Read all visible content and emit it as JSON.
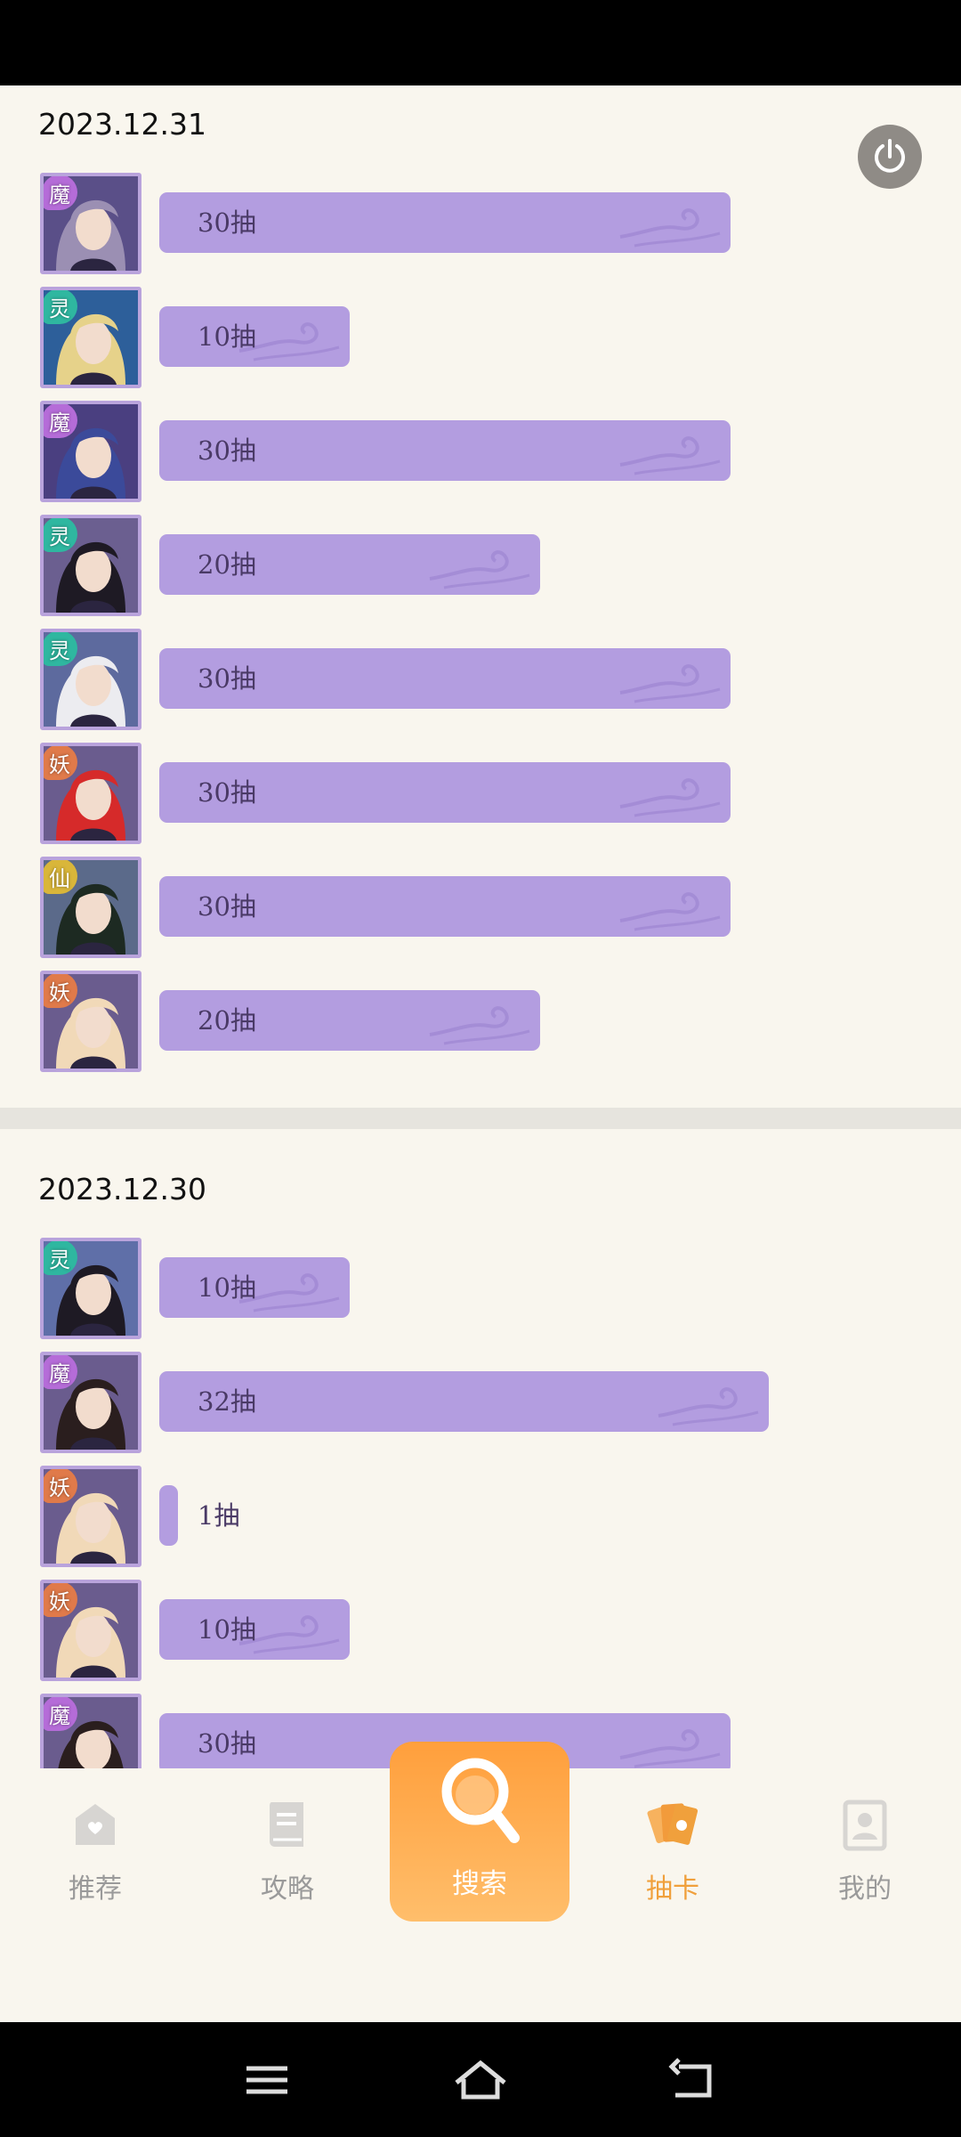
{
  "sections": [
    {
      "date": "2023.12.31",
      "rows": [
        {
          "faction": "魔",
          "faction_color": "#b56cd8",
          "hair": "#9b8fb3",
          "bg": "#5a4f88",
          "pulls": 30,
          "label": "30抽"
        },
        {
          "faction": "灵",
          "faction_color": "#2fb7a0",
          "hair": "#e6d28a",
          "bg": "#2d5f9a",
          "pulls": 10,
          "label": "10抽"
        },
        {
          "faction": "魔",
          "faction_color": "#b56cd8",
          "hair": "#3b4a9a",
          "bg": "#4a3f80",
          "pulls": 30,
          "label": "30抽"
        },
        {
          "faction": "灵",
          "faction_color": "#2fb7a0",
          "hair": "#1e1a24",
          "bg": "#6b5f90",
          "pulls": 20,
          "label": "20抽"
        },
        {
          "faction": "灵",
          "faction_color": "#2fb7a0",
          "hair": "#ececf0",
          "bg": "#5d6a9e",
          "pulls": 30,
          "label": "30抽"
        },
        {
          "faction": "妖",
          "faction_color": "#e07a4a",
          "hair": "#d62a2a",
          "bg": "#6a5c8e",
          "pulls": 30,
          "label": "30抽"
        },
        {
          "faction": "仙",
          "faction_color": "#d9b63a",
          "hair": "#1d2a22",
          "bg": "#5b6a8a",
          "pulls": 30,
          "label": "30抽"
        },
        {
          "faction": "妖",
          "faction_color": "#e07a4a",
          "hair": "#f1d9b8",
          "bg": "#6a5c8e",
          "pulls": 20,
          "label": "20抽"
        }
      ]
    },
    {
      "date": "2023.12.30",
      "rows": [
        {
          "faction": "灵",
          "faction_color": "#2fb7a0",
          "hair": "#1e1a24",
          "bg": "#5f6fa8",
          "pulls": 10,
          "label": "10抽"
        },
        {
          "faction": "魔",
          "faction_color": "#b56cd8",
          "hair": "#2a1e1e",
          "bg": "#6a5c8e",
          "pulls": 32,
          "label": "32抽"
        },
        {
          "faction": "妖",
          "faction_color": "#e07a4a",
          "hair": "#f1d9b8",
          "bg": "#6a5c8e",
          "pulls": 1,
          "label": "1抽"
        },
        {
          "faction": "妖",
          "faction_color": "#e07a4a",
          "hair": "#f1d9b8",
          "bg": "#6a5c8e",
          "pulls": 10,
          "label": "10抽"
        },
        {
          "faction": "魔",
          "faction_color": "#b56cd8",
          "hair": "#2a1e1e",
          "bg": "#6a5c8e",
          "pulls": 30,
          "label": "30抽"
        }
      ]
    }
  ],
  "tabs": [
    {
      "label": "推荐",
      "icon": "recommend-icon",
      "active": false
    },
    {
      "label": "攻略",
      "icon": "guide-book-icon",
      "active": false
    },
    {
      "label": "搜索",
      "icon": "search-icon",
      "active": false
    },
    {
      "label": "抽卡",
      "icon": "cards-icon",
      "active": true
    },
    {
      "label": "我的",
      "icon": "profile-icon",
      "active": false
    }
  ],
  "colors": {
    "accent": "#f0a03c",
    "bar": "#b39de0",
    "background": "#f9f6ee"
  }
}
